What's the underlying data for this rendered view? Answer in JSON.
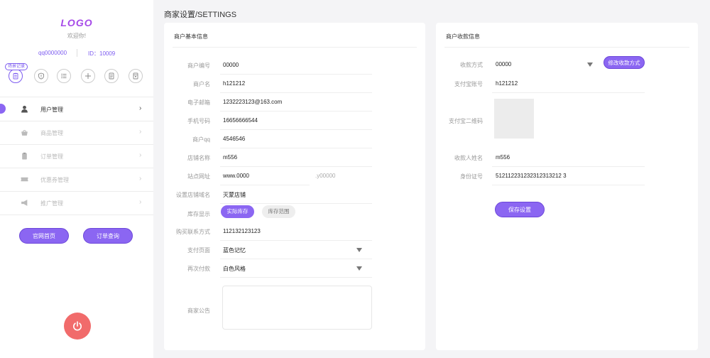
{
  "sidebar": {
    "logo": "LOGO",
    "welcome": "欢迎你!",
    "qq": "qq0000000",
    "id_text": "ID：10009",
    "quick_badge": "场景记录",
    "quick_icons": [
      "clipboard-icon",
      "shield-icon",
      "list-icon",
      "plus-icon",
      "document-icon",
      "archive-icon"
    ],
    "nav": [
      {
        "label": "用户管理",
        "icon": "user-icon",
        "active": true
      },
      {
        "label": "商品管理",
        "icon": "basket-icon",
        "active": false
      },
      {
        "label": "订单管理",
        "icon": "clipboard-icon",
        "active": false
      },
      {
        "label": "优惠券管理",
        "icon": "ticket-icon",
        "active": false
      },
      {
        "label": "推广管理",
        "icon": "megaphone-icon",
        "active": false
      }
    ],
    "buttons": {
      "home": "官网首页",
      "orders": "订单查询"
    },
    "accent": "#8b66f2",
    "power_color": "#f16b6b"
  },
  "header": {
    "title": "商家设置/SETTINGS"
  },
  "basic": {
    "title": "商户基本信息",
    "merchant_no_label": "商户编号",
    "merchant_no": "00000",
    "merchant_name_label": "商户名",
    "merchant_name": "h121212",
    "email_label": "电子邮箱",
    "email": "1232223123@163.com",
    "phone_label": "手机号码",
    "phone": "16656666544",
    "qq_label": "商户qq",
    "qq": "4546546",
    "shop_name_label": "店铺名称",
    "shop_name": "m556",
    "site_label": "站点网址",
    "site": "www.0000",
    "site_suffix": ".y00000",
    "shop_domain_label": "设置店铺域名",
    "shop_domain": "灭蒙店铺",
    "stock_label": "库存显示",
    "stock_on": "实际库存",
    "stock_off": "库存范围",
    "contact_label": "购买联系方式",
    "contact": "112132123123",
    "pay_page_label": "支付页面",
    "pay_page": "蓝色记忆",
    "repay_label": "再次付款",
    "repay": "白色风格",
    "notice_label": "商家公告",
    "notice": ""
  },
  "payment": {
    "title": "商户收款信息",
    "method_label": "收款方式",
    "method": "00000",
    "change_button": "修改收款方式",
    "alipay_label": "支付宝账号",
    "alipay": "h121212",
    "qr_label": "支付宝二维码",
    "payee_label": "收款人姓名",
    "payee": "m556",
    "idcard_label": "身份证号",
    "idcard": "512112231232312313212 3",
    "save_button": "保存设置"
  }
}
